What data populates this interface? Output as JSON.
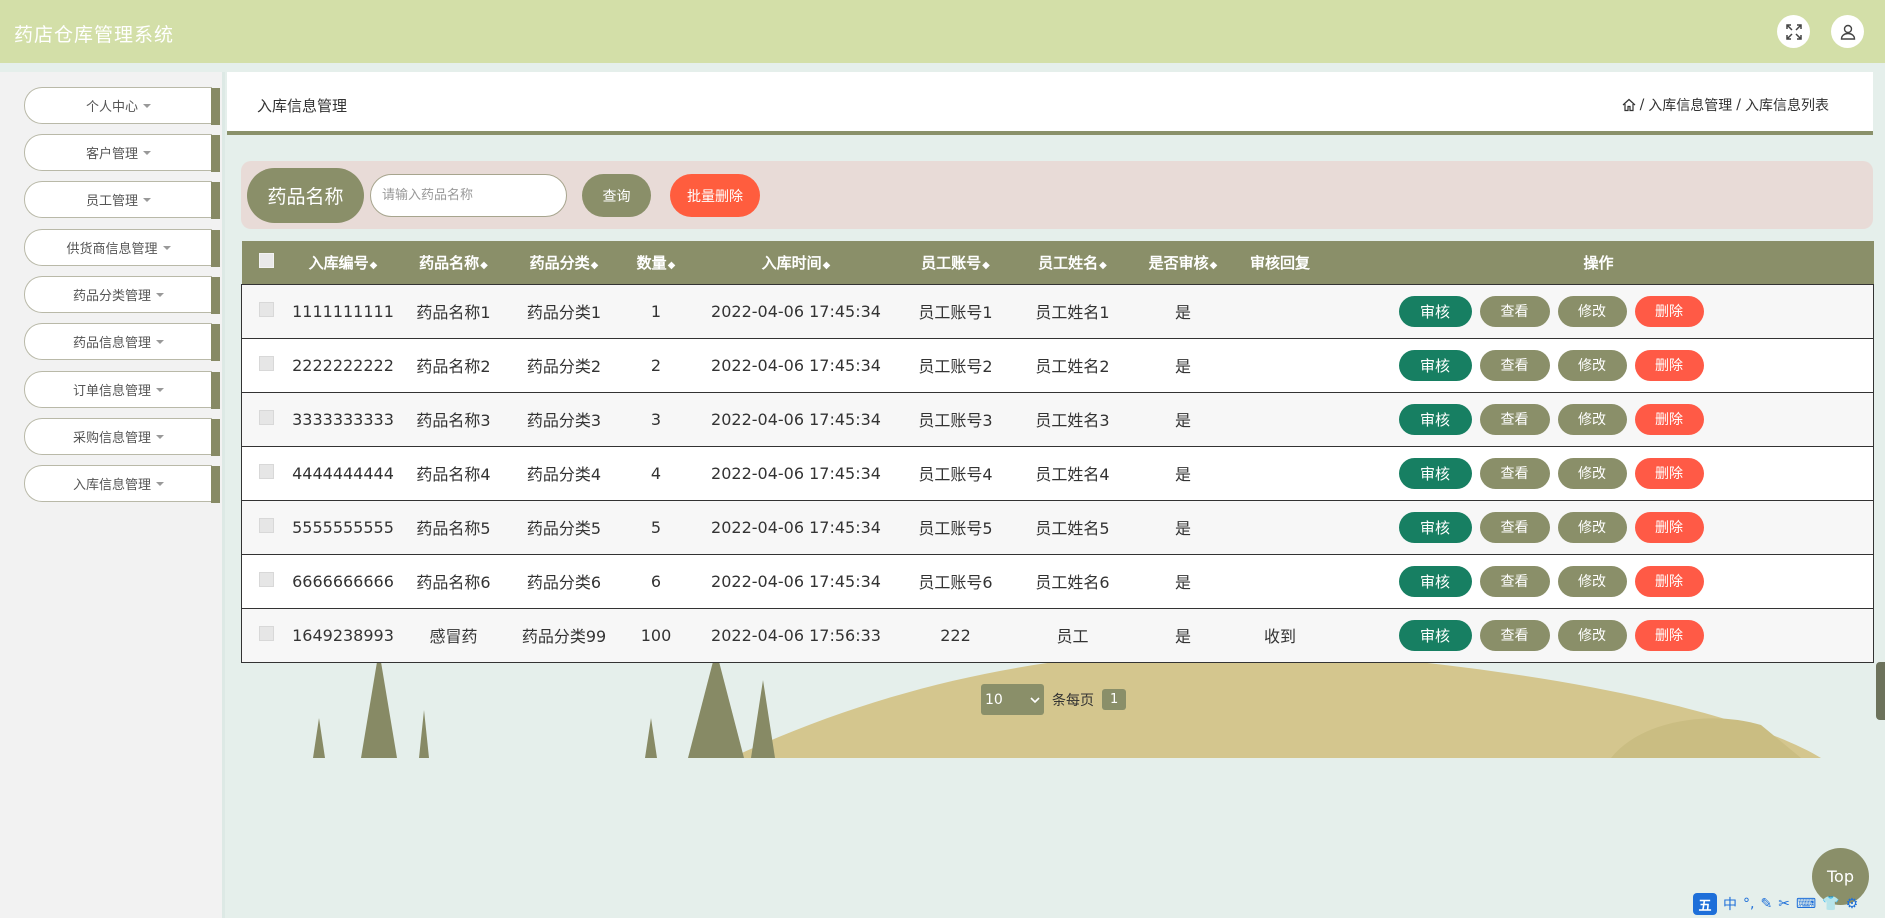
{
  "header": {
    "app_title": "药店仓库管理系统",
    "fullscreen_icon": "fullscreen-icon",
    "user_icon": "user-icon"
  },
  "sidebar": {
    "items": [
      {
        "label": "个人中心"
      },
      {
        "label": "客户管理"
      },
      {
        "label": "员工管理"
      },
      {
        "label": "供货商信息管理"
      },
      {
        "label": "药品分类管理"
      },
      {
        "label": "药品信息管理"
      },
      {
        "label": "订单信息管理"
      },
      {
        "label": "采购信息管理"
      },
      {
        "label": "入库信息管理"
      }
    ]
  },
  "page": {
    "title": "入库信息管理",
    "breadcrumb": [
      "入库信息管理",
      "入库信息列表"
    ],
    "separator": "/"
  },
  "search": {
    "label": "药品名称",
    "placeholder": "请输入药品名称",
    "value": "",
    "query_label": "查询",
    "batch_delete_label": "批量删除"
  },
  "table": {
    "columns": [
      "入库编号",
      "药品名称",
      "药品分类",
      "数量",
      "入库时间",
      "员工账号",
      "员工姓名",
      "是否审核",
      "审核回复",
      "操作"
    ],
    "sort_glyph": "◆",
    "rows": [
      {
        "id": "1111111111",
        "name": "药品名称1",
        "category": "药品分类1",
        "qty": "1",
        "time": "2022-04-06 17:45:34",
        "account": "员工账号1",
        "staff": "员工姓名1",
        "audited": "是",
        "reply": ""
      },
      {
        "id": "2222222222",
        "name": "药品名称2",
        "category": "药品分类2",
        "qty": "2",
        "time": "2022-04-06 17:45:34",
        "account": "员工账号2",
        "staff": "员工姓名2",
        "audited": "是",
        "reply": ""
      },
      {
        "id": "3333333333",
        "name": "药品名称3",
        "category": "药品分类3",
        "qty": "3",
        "time": "2022-04-06 17:45:34",
        "account": "员工账号3",
        "staff": "员工姓名3",
        "audited": "是",
        "reply": ""
      },
      {
        "id": "4444444444",
        "name": "药品名称4",
        "category": "药品分类4",
        "qty": "4",
        "time": "2022-04-06 17:45:34",
        "account": "员工账号4",
        "staff": "员工姓名4",
        "audited": "是",
        "reply": ""
      },
      {
        "id": "5555555555",
        "name": "药品名称5",
        "category": "药品分类5",
        "qty": "5",
        "time": "2022-04-06 17:45:34",
        "account": "员工账号5",
        "staff": "员工姓名5",
        "audited": "是",
        "reply": ""
      },
      {
        "id": "6666666666",
        "name": "药品名称6",
        "category": "药品分类6",
        "qty": "6",
        "time": "2022-04-06 17:45:34",
        "account": "员工账号6",
        "staff": "员工姓名6",
        "audited": "是",
        "reply": ""
      },
      {
        "id": "1649238993",
        "name": "感冒药",
        "category": "药品分类99",
        "qty": "100",
        "time": "2022-04-06 17:56:33",
        "account": "222",
        "staff": "员工",
        "audited": "是",
        "reply": "收到"
      }
    ],
    "actions": {
      "audit": "审核",
      "view": "查看",
      "edit": "修改",
      "delete": "删除"
    }
  },
  "pagination": {
    "page_size": "10",
    "per_page_label": "条每页",
    "current_page": "1"
  },
  "back_to_top": "Top",
  "ime": {
    "logo": "五",
    "items": [
      "中",
      "°,",
      "✎",
      "✂",
      "⌨",
      "👕",
      "⚙"
    ]
  },
  "colors": {
    "header_bg": "#d3dfa8",
    "primary": "#8a8f69",
    "danger": "#ff5d3e",
    "audit": "#177f62"
  }
}
